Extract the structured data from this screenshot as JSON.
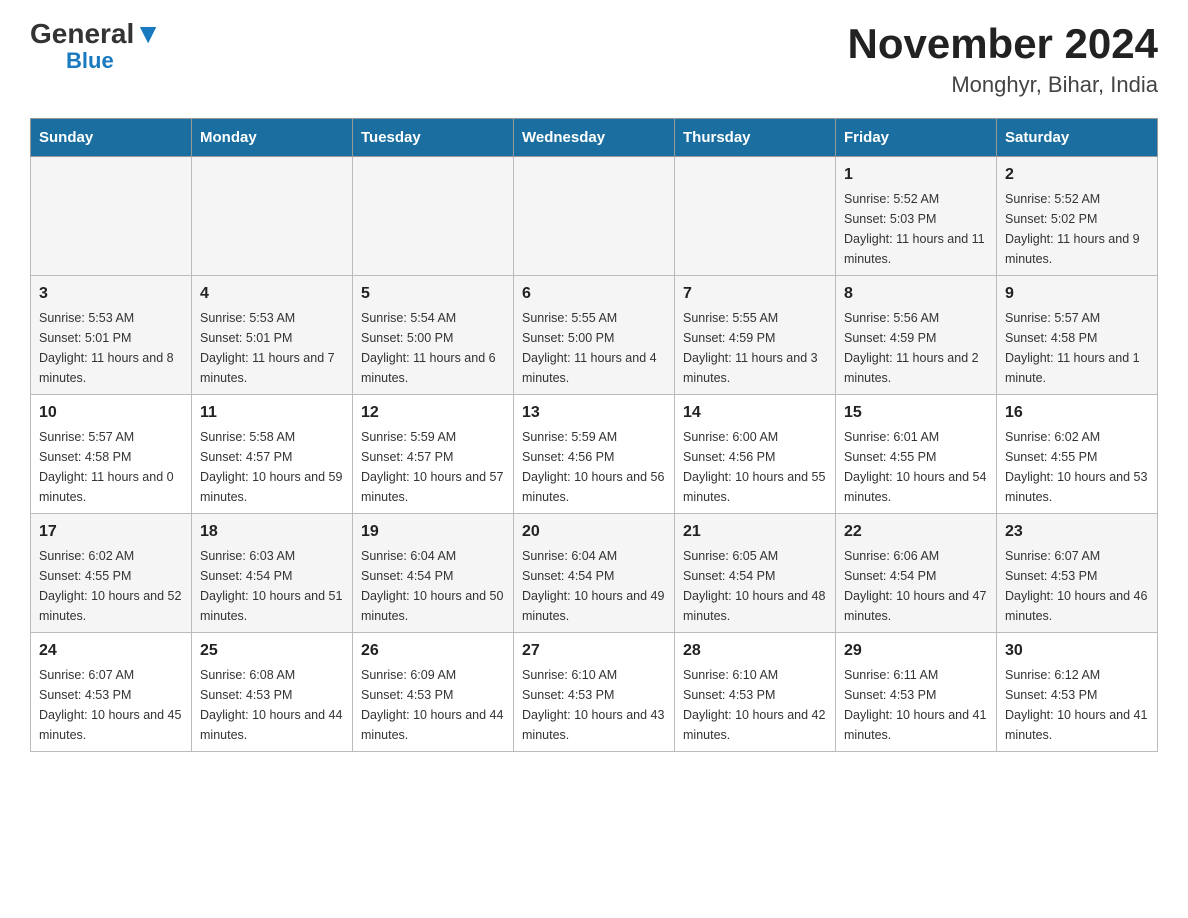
{
  "header": {
    "logo_general": "General",
    "logo_blue": "Blue",
    "title": "November 2024",
    "subtitle": "Monghyr, Bihar, India"
  },
  "days_of_week": [
    "Sunday",
    "Monday",
    "Tuesday",
    "Wednesday",
    "Thursday",
    "Friday",
    "Saturday"
  ],
  "weeks": [
    [
      {
        "day": "",
        "sunrise": "",
        "sunset": "",
        "daylight": "",
        "empty": true
      },
      {
        "day": "",
        "sunrise": "",
        "sunset": "",
        "daylight": "",
        "empty": true
      },
      {
        "day": "",
        "sunrise": "",
        "sunset": "",
        "daylight": "",
        "empty": true
      },
      {
        "day": "",
        "sunrise": "",
        "sunset": "",
        "daylight": "",
        "empty": true
      },
      {
        "day": "",
        "sunrise": "",
        "sunset": "",
        "daylight": "",
        "empty": true
      },
      {
        "day": "1",
        "sunrise": "Sunrise: 5:52 AM",
        "sunset": "Sunset: 5:03 PM",
        "daylight": "Daylight: 11 hours and 11 minutes.",
        "empty": false
      },
      {
        "day": "2",
        "sunrise": "Sunrise: 5:52 AM",
        "sunset": "Sunset: 5:02 PM",
        "daylight": "Daylight: 11 hours and 9 minutes.",
        "empty": false
      }
    ],
    [
      {
        "day": "3",
        "sunrise": "Sunrise: 5:53 AM",
        "sunset": "Sunset: 5:01 PM",
        "daylight": "Daylight: 11 hours and 8 minutes.",
        "empty": false
      },
      {
        "day": "4",
        "sunrise": "Sunrise: 5:53 AM",
        "sunset": "Sunset: 5:01 PM",
        "daylight": "Daylight: 11 hours and 7 minutes.",
        "empty": false
      },
      {
        "day": "5",
        "sunrise": "Sunrise: 5:54 AM",
        "sunset": "Sunset: 5:00 PM",
        "daylight": "Daylight: 11 hours and 6 minutes.",
        "empty": false
      },
      {
        "day": "6",
        "sunrise": "Sunrise: 5:55 AM",
        "sunset": "Sunset: 5:00 PM",
        "daylight": "Daylight: 11 hours and 4 minutes.",
        "empty": false
      },
      {
        "day": "7",
        "sunrise": "Sunrise: 5:55 AM",
        "sunset": "Sunset: 4:59 PM",
        "daylight": "Daylight: 11 hours and 3 minutes.",
        "empty": false
      },
      {
        "day": "8",
        "sunrise": "Sunrise: 5:56 AM",
        "sunset": "Sunset: 4:59 PM",
        "daylight": "Daylight: 11 hours and 2 minutes.",
        "empty": false
      },
      {
        "day": "9",
        "sunrise": "Sunrise: 5:57 AM",
        "sunset": "Sunset: 4:58 PM",
        "daylight": "Daylight: 11 hours and 1 minute.",
        "empty": false
      }
    ],
    [
      {
        "day": "10",
        "sunrise": "Sunrise: 5:57 AM",
        "sunset": "Sunset: 4:58 PM",
        "daylight": "Daylight: 11 hours and 0 minutes.",
        "empty": false
      },
      {
        "day": "11",
        "sunrise": "Sunrise: 5:58 AM",
        "sunset": "Sunset: 4:57 PM",
        "daylight": "Daylight: 10 hours and 59 minutes.",
        "empty": false
      },
      {
        "day": "12",
        "sunrise": "Sunrise: 5:59 AM",
        "sunset": "Sunset: 4:57 PM",
        "daylight": "Daylight: 10 hours and 57 minutes.",
        "empty": false
      },
      {
        "day": "13",
        "sunrise": "Sunrise: 5:59 AM",
        "sunset": "Sunset: 4:56 PM",
        "daylight": "Daylight: 10 hours and 56 minutes.",
        "empty": false
      },
      {
        "day": "14",
        "sunrise": "Sunrise: 6:00 AM",
        "sunset": "Sunset: 4:56 PM",
        "daylight": "Daylight: 10 hours and 55 minutes.",
        "empty": false
      },
      {
        "day": "15",
        "sunrise": "Sunrise: 6:01 AM",
        "sunset": "Sunset: 4:55 PM",
        "daylight": "Daylight: 10 hours and 54 minutes.",
        "empty": false
      },
      {
        "day": "16",
        "sunrise": "Sunrise: 6:02 AM",
        "sunset": "Sunset: 4:55 PM",
        "daylight": "Daylight: 10 hours and 53 minutes.",
        "empty": false
      }
    ],
    [
      {
        "day": "17",
        "sunrise": "Sunrise: 6:02 AM",
        "sunset": "Sunset: 4:55 PM",
        "daylight": "Daylight: 10 hours and 52 minutes.",
        "empty": false
      },
      {
        "day": "18",
        "sunrise": "Sunrise: 6:03 AM",
        "sunset": "Sunset: 4:54 PM",
        "daylight": "Daylight: 10 hours and 51 minutes.",
        "empty": false
      },
      {
        "day": "19",
        "sunrise": "Sunrise: 6:04 AM",
        "sunset": "Sunset: 4:54 PM",
        "daylight": "Daylight: 10 hours and 50 minutes.",
        "empty": false
      },
      {
        "day": "20",
        "sunrise": "Sunrise: 6:04 AM",
        "sunset": "Sunset: 4:54 PM",
        "daylight": "Daylight: 10 hours and 49 minutes.",
        "empty": false
      },
      {
        "day": "21",
        "sunrise": "Sunrise: 6:05 AM",
        "sunset": "Sunset: 4:54 PM",
        "daylight": "Daylight: 10 hours and 48 minutes.",
        "empty": false
      },
      {
        "day": "22",
        "sunrise": "Sunrise: 6:06 AM",
        "sunset": "Sunset: 4:54 PM",
        "daylight": "Daylight: 10 hours and 47 minutes.",
        "empty": false
      },
      {
        "day": "23",
        "sunrise": "Sunrise: 6:07 AM",
        "sunset": "Sunset: 4:53 PM",
        "daylight": "Daylight: 10 hours and 46 minutes.",
        "empty": false
      }
    ],
    [
      {
        "day": "24",
        "sunrise": "Sunrise: 6:07 AM",
        "sunset": "Sunset: 4:53 PM",
        "daylight": "Daylight: 10 hours and 45 minutes.",
        "empty": false
      },
      {
        "day": "25",
        "sunrise": "Sunrise: 6:08 AM",
        "sunset": "Sunset: 4:53 PM",
        "daylight": "Daylight: 10 hours and 44 minutes.",
        "empty": false
      },
      {
        "day": "26",
        "sunrise": "Sunrise: 6:09 AM",
        "sunset": "Sunset: 4:53 PM",
        "daylight": "Daylight: 10 hours and 44 minutes.",
        "empty": false
      },
      {
        "day": "27",
        "sunrise": "Sunrise: 6:10 AM",
        "sunset": "Sunset: 4:53 PM",
        "daylight": "Daylight: 10 hours and 43 minutes.",
        "empty": false
      },
      {
        "day": "28",
        "sunrise": "Sunrise: 6:10 AM",
        "sunset": "Sunset: 4:53 PM",
        "daylight": "Daylight: 10 hours and 42 minutes.",
        "empty": false
      },
      {
        "day": "29",
        "sunrise": "Sunrise: 6:11 AM",
        "sunset": "Sunset: 4:53 PM",
        "daylight": "Daylight: 10 hours and 41 minutes.",
        "empty": false
      },
      {
        "day": "30",
        "sunrise": "Sunrise: 6:12 AM",
        "sunset": "Sunset: 4:53 PM",
        "daylight": "Daylight: 10 hours and 41 minutes.",
        "empty": false
      }
    ]
  ]
}
